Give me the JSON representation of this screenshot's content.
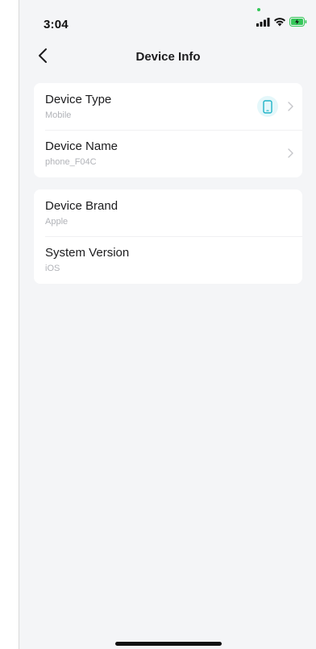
{
  "status_bar": {
    "time": "3:04",
    "icons": [
      "signal-icon",
      "wifi-icon",
      "battery-charging-icon"
    ],
    "privacy_indicator_color": "#34c759"
  },
  "nav": {
    "title": "Device Info",
    "back_icon": "chevron-left-icon"
  },
  "sections": [
    {
      "rows": [
        {
          "label": "Device Type",
          "value": "Mobile",
          "icon": "mobile-phone-icon",
          "has_chevron": true
        },
        {
          "label": "Device Name",
          "value": "phone_F04C",
          "has_chevron": true
        }
      ]
    },
    {
      "rows": [
        {
          "label": "Device Brand",
          "value": "Apple",
          "has_chevron": false
        },
        {
          "label": "System Version",
          "value": "iOS",
          "has_chevron": false
        }
      ]
    }
  ],
  "colors": {
    "accent": "#1fb3c7",
    "accent_bg": "#e4f7fa",
    "page_bg": "#f4f5f7",
    "battery": "#34c759"
  }
}
